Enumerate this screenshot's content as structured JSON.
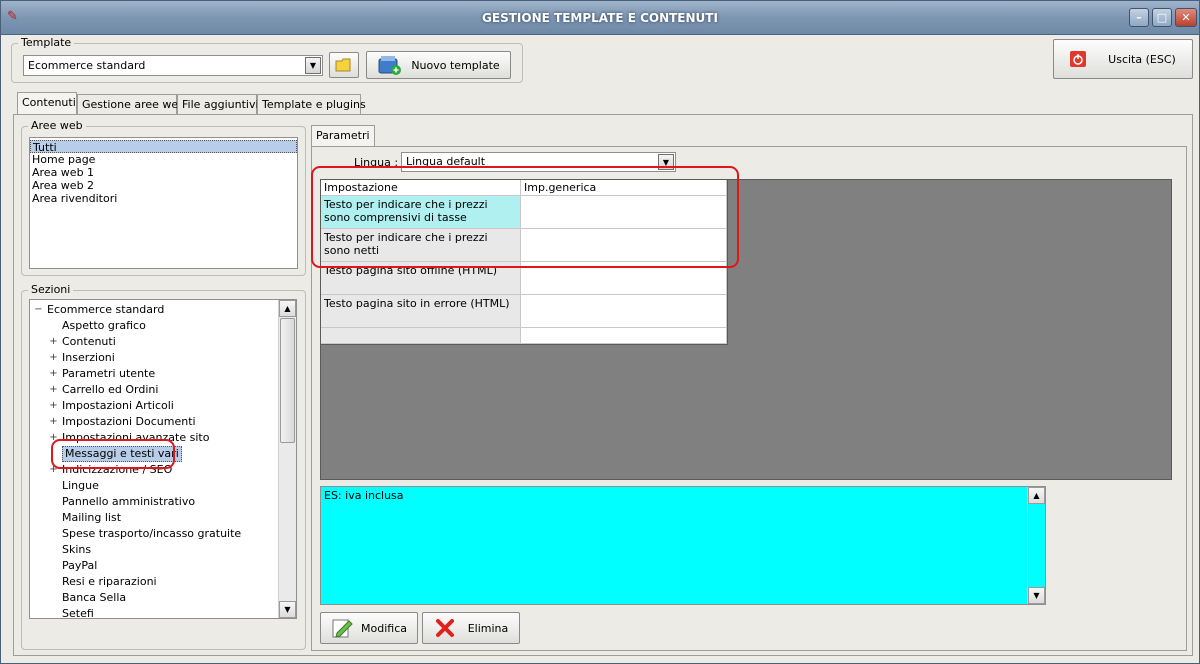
{
  "window": {
    "title": "GESTIONE TEMPLATE E CONTENUTI"
  },
  "template_group": {
    "label": "Template",
    "selected": "Ecommerce standard",
    "new_button": "Nuovo template"
  },
  "exit_button": "Uscita (ESC)",
  "tabs": [
    "Contenuti",
    "Gestione aree web",
    "File aggiuntivi",
    "Template e plugins"
  ],
  "aree_web": {
    "label": "Aree web",
    "items": [
      "Tutti",
      "Home page",
      "Area web 1",
      "Area web 2",
      "Area rivenditori"
    ]
  },
  "sezioni": {
    "label": "Sezioni",
    "items": [
      {
        "label": "Ecommerce standard",
        "expand": "−"
      },
      {
        "label": "Aspetto grafico",
        "expand": ""
      },
      {
        "label": "Contenuti",
        "expand": "+"
      },
      {
        "label": "Inserzioni",
        "expand": "+"
      },
      {
        "label": "Parametri utente",
        "expand": "+"
      },
      {
        "label": "Carrello ed Ordini",
        "expand": "+"
      },
      {
        "label": "Impostazioni Articoli",
        "expand": "+"
      },
      {
        "label": "Impostazioni Documenti",
        "expand": "+"
      },
      {
        "label": "Impostazioni avanzate sito",
        "expand": "+"
      },
      {
        "label": "Messaggi e testi vari",
        "expand": ""
      },
      {
        "label": "Indicizzazione / SEO",
        "expand": "+"
      },
      {
        "label": "Lingue",
        "expand": ""
      },
      {
        "label": "Pannello amministrativo",
        "expand": ""
      },
      {
        "label": "Mailing list",
        "expand": ""
      },
      {
        "label": "Spese trasporto/incasso gratuite",
        "expand": ""
      },
      {
        "label": "Skins",
        "expand": ""
      },
      {
        "label": "PayPal",
        "expand": ""
      },
      {
        "label": "Resi e riparazioni",
        "expand": ""
      },
      {
        "label": "Banca Sella",
        "expand": ""
      },
      {
        "label": "Setefi",
        "expand": ""
      }
    ]
  },
  "parametri": {
    "tab": "Parametri",
    "lingua_label": "Lingua :",
    "lingua_value": "Lingua default",
    "columns": [
      "Impostazione",
      "Imp.generica"
    ],
    "rows": [
      {
        "name": "Testo per indicare che i prezzi sono comprensivi di tasse",
        "value": ""
      },
      {
        "name": "Testo per indicare che i prezzi sono netti",
        "value": ""
      },
      {
        "name": "Testo pagina sito offline (HTML)",
        "value": ""
      },
      {
        "name": "Testo pagina sito in errore (HTML)",
        "value": ""
      },
      {
        "name": "",
        "value": ""
      }
    ],
    "preview_text": "ES: iva inclusa",
    "modifica": "Modifica",
    "elimina": "Elimina"
  },
  "colors": {
    "grid_area": "#808080",
    "preview_bg": "#00ffff",
    "selected_row": "#b0f0f0",
    "highlight": "#e0161a"
  }
}
